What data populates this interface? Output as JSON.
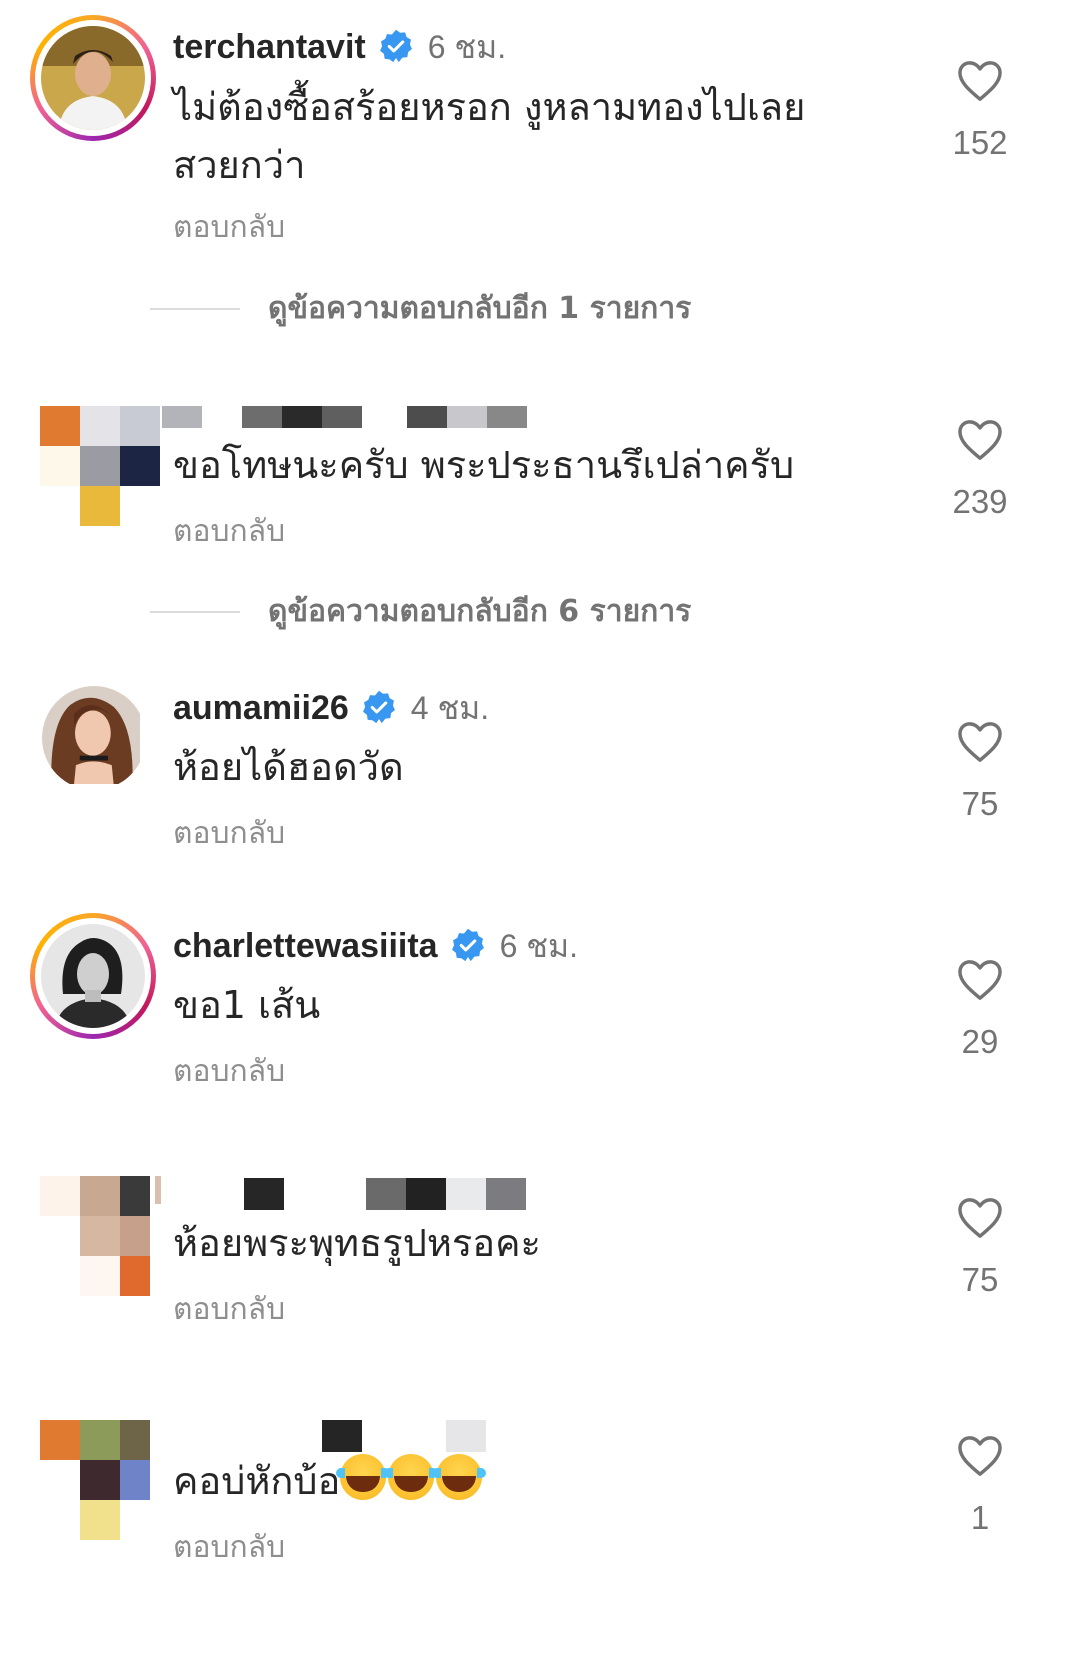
{
  "comments": [
    {
      "username": "terchantavit",
      "verified": true,
      "time": "6 ชม.",
      "text_line1": "ไม่ต้องซื้อสร้อยหรอก งูหลามทองไปเลย",
      "text_line2": "สวยกว่า",
      "reply": "ตอบกลับ",
      "likes": "152",
      "view_replies": "ดูข้อความตอบกลับอีก 1 รายการ"
    },
    {
      "username": "",
      "verified": false,
      "text": "ขอโทษนะครับ พระประธานรึเปล่าครับ",
      "reply": "ตอบกลับ",
      "likes": "239",
      "view_replies": "ดูข้อความตอบกลับอีก 6 รายการ"
    },
    {
      "username": "aumamii26",
      "verified": true,
      "time": "4 ชม.",
      "text": "ห้อยได้ฮอดวัด",
      "reply": "ตอบกลับ",
      "likes": "75"
    },
    {
      "username": "charlettewasiiita",
      "verified": true,
      "time": "6 ชม.",
      "text": "ขอ1 เส้น",
      "reply": "ตอบกลับ",
      "likes": "29"
    },
    {
      "username": "",
      "verified": false,
      "text": "ห้อยพระพุทธรูปหรอคะ",
      "reply": "ตอบกลับ",
      "likes": "75"
    },
    {
      "username": "",
      "verified": false,
      "text": "คอบ่หักบ้อ",
      "emoji": "face-with-tears-of-joy x3",
      "reply": "ตอบกลับ",
      "likes": "1"
    }
  ],
  "colors": {
    "verified": "#3897f0",
    "secondary_text": "#737373",
    "divider": "#dbdbdb"
  },
  "icons": [
    "heart-icon",
    "verified-badge-icon",
    "face-with-tears-of-joy-emoji"
  ]
}
